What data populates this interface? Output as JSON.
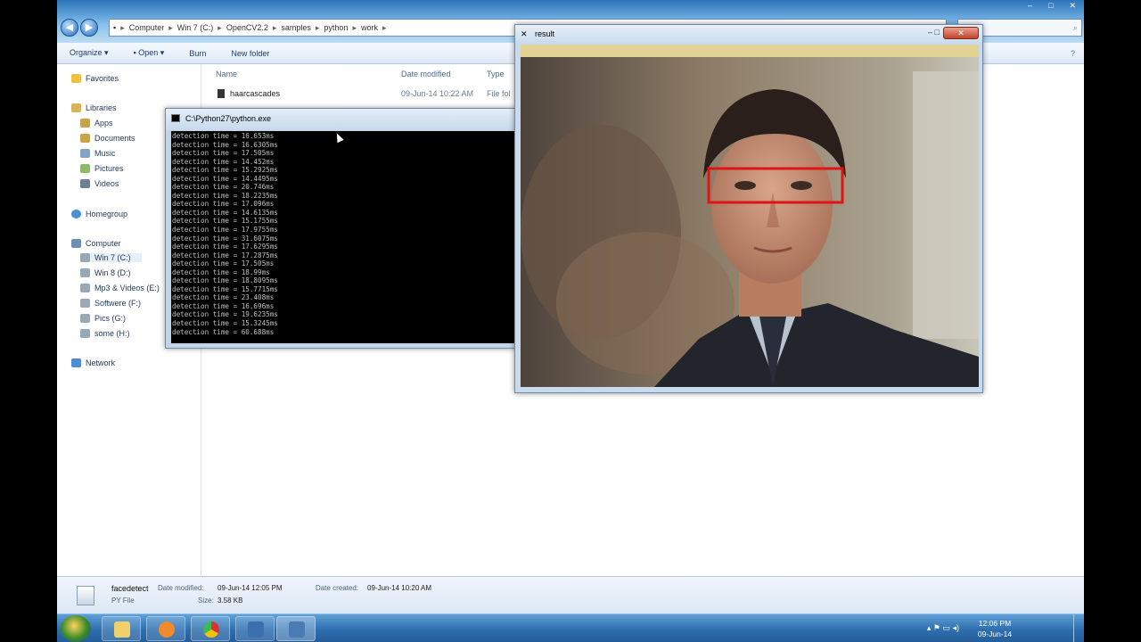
{
  "explorer": {
    "address_parts": [
      "Computer",
      "Win 7 (C:)",
      "OpenCV2.2",
      "samples",
      "python",
      "work"
    ],
    "toolbar": [
      "Organize",
      "Open",
      "Burn",
      "New folder"
    ],
    "nav": [
      {
        "label": "Favorites",
        "group": true
      },
      {
        "label": "Libraries",
        "group": true
      },
      {
        "label": "Apps"
      },
      {
        "label": "Documents"
      },
      {
        "label": "Music"
      },
      {
        "label": "Pictures"
      },
      {
        "label": "Videos"
      },
      {
        "label": "Homegroup",
        "group": true
      },
      {
        "label": "Computer",
        "group": true
      },
      {
        "label": "Win 7 (C:)",
        "selected": true
      },
      {
        "label": "Win 8 (D:)"
      },
      {
        "label": "Mp3 & Videos (E:)"
      },
      {
        "label": "Softwere (F:)"
      },
      {
        "label": "Pics (G:)"
      },
      {
        "label": "some (H:)"
      },
      {
        "label": "Network",
        "group": true
      }
    ],
    "columns": {
      "name": "Name",
      "date": "Date modified",
      "type": "Type"
    },
    "rows": [
      {
        "name": "haarcascades",
        "date": "09-Jun-14 10:22 AM",
        "type": "File fol"
      }
    ],
    "details": {
      "filename": "facedetect",
      "filetype": "PY File",
      "modified_label": "Date modified:",
      "modified_value": "09-Jun-14 12:05 PM",
      "created_label": "Date created:",
      "created_value": "09-Jun-14 10:20 AM",
      "size_label": "Size:",
      "size_value": "3.58 KB"
    }
  },
  "console": {
    "title": "C:\\Python27\\python.exe",
    "lines": [
      "detection time = 16.653ms",
      "detection time = 16.6305ms",
      "detection time = 17.505ms",
      "detection time = 14.452ms",
      "detection time = 15.2925ms",
      "detection time = 14.4495ms",
      "detection time = 20.746ms",
      "detection time = 18.2235ms",
      "detection time = 17.096ms",
      "detection time = 14.6135ms",
      "detection time = 15.1755ms",
      "detection time = 17.9755ms",
      "detection time = 31.6075ms",
      "detection time = 17.6295ms",
      "detection time = 17.2875ms",
      "detection time = 17.505ms",
      "detection time = 18.99ms",
      "detection time = 18.8095ms",
      "detection time = 15.7715ms",
      "detection time = 23.408ms",
      "detection time = 16.696ms",
      "detection time = 19.6235ms",
      "detection time = 15.3245ms",
      "detection time = 60.688ms"
    ]
  },
  "result_window": {
    "title": "result"
  },
  "taskbar": {
    "time": "12:06 PM",
    "date": "09-Jun-14"
  }
}
